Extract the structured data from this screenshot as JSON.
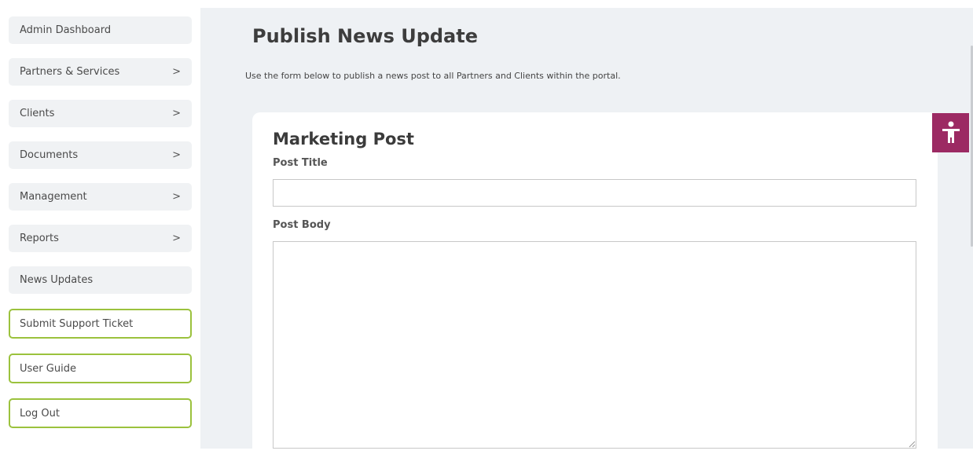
{
  "sidebar": {
    "items": [
      {
        "label": "Admin Dashboard",
        "chevron": ""
      },
      {
        "label": "Partners & Services",
        "chevron": ">"
      },
      {
        "label": "Clients",
        "chevron": ">"
      },
      {
        "label": "Documents",
        "chevron": ">"
      },
      {
        "label": "Management",
        "chevron": ">"
      },
      {
        "label": "Reports",
        "chevron": ">"
      },
      {
        "label": "News Updates",
        "chevron": ""
      }
    ],
    "outlined_items": [
      {
        "label": "Submit Support Ticket"
      },
      {
        "label": "User Guide"
      },
      {
        "label": "Log Out"
      }
    ],
    "outline_color": "#9bc23d"
  },
  "main": {
    "title": "Publish News Update",
    "description": "Use the form below to publish a news post to all Partners and Clients within the portal."
  },
  "form": {
    "card_title": "Marketing Post",
    "post_title_label": "Post Title",
    "post_title_value": "",
    "post_body_label": "Post Body",
    "post_body_value": ""
  },
  "accessibility": {
    "icon": "accessibility-person-icon",
    "color": "#9c2a63"
  }
}
